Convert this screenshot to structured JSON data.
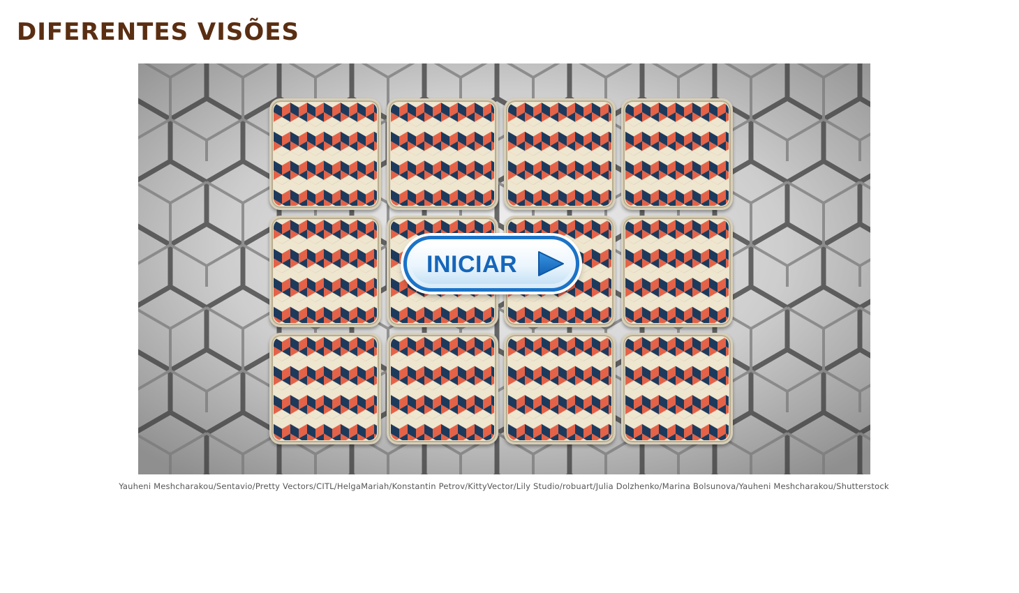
{
  "page": {
    "title": "DIFERENTES VISÕES"
  },
  "game": {
    "start_button_label": "INICIAR",
    "card_count": 12,
    "card_rows": 3,
    "card_columns": 4,
    "start_icon": "play-arrow-icon"
  },
  "credits": {
    "text": "Yauheni Meshcharakou/Sentavio/Pretty Vectors/CITL/HelgaMariah/Konstantin Petrov/KittyVector/Lily Studio/robuart/Julia Dolzhenko/Marina Bolsunova/Yauheni Meshcharakou/Shutterstock"
  },
  "colors": {
    "title": "#5a2e12",
    "button_border": "#1b73c8",
    "button_text": "#1566b9",
    "card_navy": "#1d3a5c",
    "card_coral": "#e46247",
    "card_cream": "#efe6cf"
  }
}
